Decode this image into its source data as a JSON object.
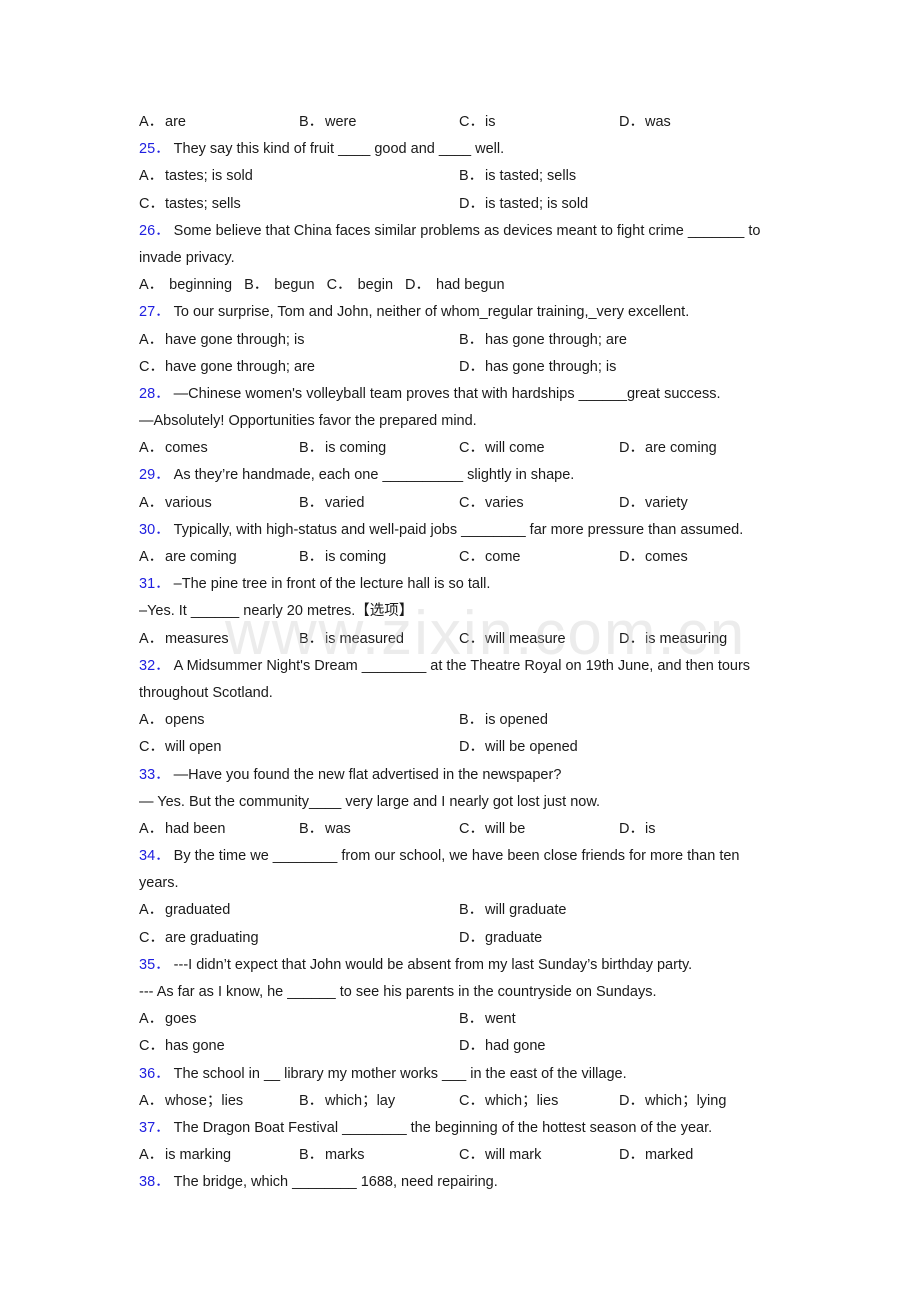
{
  "watermark": "www.zixin.com.cn",
  "prev_options": [
    {
      "letter": "A．",
      "text": "are"
    },
    {
      "letter": "B．",
      "text": "were"
    },
    {
      "letter": "C．",
      "text": "is"
    },
    {
      "letter": "D．",
      "text": "was"
    }
  ],
  "questions": [
    {
      "number": "25．",
      "lines": [
        "They say this kind of fruit ____ good and ____ well."
      ],
      "layout": "two",
      "options": [
        {
          "letter": "A．",
          "text": "tastes; is sold"
        },
        {
          "letter": "B．",
          "text": "is tasted; sells"
        },
        {
          "letter": "C．",
          "text": "tastes; sells"
        },
        {
          "letter": "D．",
          "text": "is tasted; is sold"
        }
      ]
    },
    {
      "number": "26．",
      "lines": [
        "Some believe that China faces similar problems as devices meant to fight crime _______ to",
        "invade privacy."
      ],
      "layout": "inline",
      "options": [
        {
          "letter": "A．",
          "text": "beginning"
        },
        {
          "letter": "B．",
          "text": "begun"
        },
        {
          "letter": "C．",
          "text": "begin"
        },
        {
          "letter": "D．",
          "text": "had begun"
        }
      ]
    },
    {
      "number": "27．",
      "lines": [
        "To our surprise, Tom and John, neither of whom_regular training,_very excellent."
      ],
      "layout": "two",
      "options": [
        {
          "letter": "A．",
          "text": "have gone through; is"
        },
        {
          "letter": "B．",
          "text": "has gone through; are"
        },
        {
          "letter": "C．",
          "text": "have gone through; are"
        },
        {
          "letter": "D．",
          "text": "has gone through; is"
        }
      ]
    },
    {
      "number": "28．",
      "lines": [
        "—Chinese women's volleyball team proves that with hardships ______great success.",
        "—Absolutely! Opportunities favor the prepared mind."
      ],
      "layout": "four",
      "options": [
        {
          "letter": "A．",
          "text": "comes"
        },
        {
          "letter": "B．",
          "text": "is coming"
        },
        {
          "letter": "C．",
          "text": "will come"
        },
        {
          "letter": "D．",
          "text": "are coming"
        }
      ]
    },
    {
      "number": "29．",
      "lines": [
        "As they’re handmade, each one __________ slightly in shape."
      ],
      "layout": "four",
      "options": [
        {
          "letter": "A．",
          "text": "various"
        },
        {
          "letter": "B．",
          "text": "varied"
        },
        {
          "letter": "C．",
          "text": "varies"
        },
        {
          "letter": "D．",
          "text": "variety"
        }
      ]
    },
    {
      "number": "30．",
      "lines": [
        "Typically, with high-status and well-paid jobs ________ far more pressure than assumed."
      ],
      "layout": "four",
      "options": [
        {
          "letter": "A．",
          "text": "are coming"
        },
        {
          "letter": "B．",
          "text": "is coming"
        },
        {
          "letter": "C．",
          "text": "come"
        },
        {
          "letter": "D．",
          "text": "comes"
        }
      ]
    },
    {
      "number": "31．",
      "lines": [
        "–The pine tree in front of the lecture hall is so tall.",
        "–Yes. It ______ nearly 20 metres.【选项】"
      ],
      "layout": "four",
      "options": [
        {
          "letter": "A．",
          "text": "measures"
        },
        {
          "letter": "B．",
          "text": "is measured"
        },
        {
          "letter": "C．",
          "text": "will measure"
        },
        {
          "letter": "D．",
          "text": "is measuring"
        }
      ]
    },
    {
      "number": "32．",
      "lines": [
        "A Midsummer Night's Dream ________ at the Theatre Royal on 19th June, and then tours",
        "throughout Scotland."
      ],
      "layout": "two",
      "options": [
        {
          "letter": "A．",
          "text": "opens"
        },
        {
          "letter": "B．",
          "text": "is opened"
        },
        {
          "letter": "C．",
          "text": "will open"
        },
        {
          "letter": "D．",
          "text": "will be opened"
        }
      ]
    },
    {
      "number": "33．",
      "lines": [
        "—Have you found the new flat advertised in the newspaper?",
        "— Yes. But the community____ very large and I nearly got lost just now."
      ],
      "layout": "four",
      "options": [
        {
          "letter": "A．",
          "text": "had been"
        },
        {
          "letter": "B．",
          "text": "was"
        },
        {
          "letter": "C．",
          "text": "will be"
        },
        {
          "letter": "D．",
          "text": "is"
        }
      ]
    },
    {
      "number": "34．",
      "lines": [
        "By the time we ________ from our school, we have been close friends for more than ten",
        "years."
      ],
      "layout": "two",
      "options": [
        {
          "letter": "A．",
          "text": "graduated"
        },
        {
          "letter": "B．",
          "text": "will graduate"
        },
        {
          "letter": "C．",
          "text": "are graduating"
        },
        {
          "letter": "D．",
          "text": "graduate"
        }
      ]
    },
    {
      "number": "35．",
      "lines": [
        "---I didn’t expect that John would be absent from my last Sunday’s birthday party.",
        "--- As far as I know, he ______ to see his parents in the countryside on Sundays."
      ],
      "layout": "two",
      "options": [
        {
          "letter": "A．",
          "text": "goes"
        },
        {
          "letter": "B．",
          "text": "went"
        },
        {
          "letter": "C．",
          "text": "has gone"
        },
        {
          "letter": "D．",
          "text": "had gone"
        }
      ]
    },
    {
      "number": "36．",
      "lines": [
        "The school in __ library my mother works ___ in the east of the village."
      ],
      "layout": "four",
      "options": [
        {
          "letter": "A．",
          "text": "whose；lies"
        },
        {
          "letter": "B．",
          "text": "which；lay"
        },
        {
          "letter": "C．",
          "text": "which；lies"
        },
        {
          "letter": "D．",
          "text": "which；lying"
        }
      ]
    },
    {
      "number": "37．",
      "lines": [
        "The Dragon Boat Festival ________ the beginning of the hottest season of the year."
      ],
      "layout": "four",
      "options": [
        {
          "letter": "A．",
          "text": "is marking"
        },
        {
          "letter": "B．",
          "text": "marks"
        },
        {
          "letter": "C．",
          "text": "will mark"
        },
        {
          "letter": "D．",
          "text": "marked"
        }
      ]
    },
    {
      "number": "38．",
      "lines": [
        "The bridge, which ________ 1688, need repairing."
      ],
      "layout": "none",
      "options": []
    }
  ]
}
